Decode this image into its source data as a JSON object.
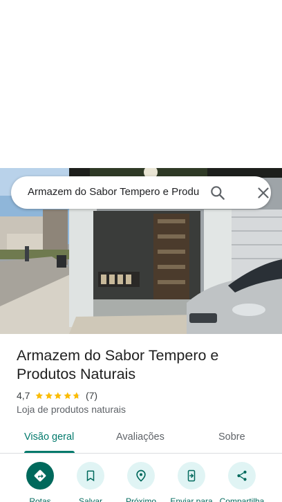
{
  "search": {
    "query": "Armazem do Sabor Tempero e Produtos Naturais"
  },
  "place": {
    "name": "Armazem do Sabor Tempero e Produtos Naturais",
    "rating": "4,7",
    "stars": 4.7,
    "reviews_count": "(7)",
    "category": "Loja de produtos naturais"
  },
  "tabs": [
    {
      "label": "Visão geral",
      "active": true
    },
    {
      "label": "Avaliações",
      "active": false
    },
    {
      "label": "Sobre",
      "active": false
    }
  ],
  "actions": [
    {
      "label": "Rotas",
      "icon": "directions-icon"
    },
    {
      "label": "Salvar",
      "icon": "bookmark-icon"
    },
    {
      "label": "Próximo",
      "icon": "nearby-icon"
    },
    {
      "label": "Enviar para",
      "icon": "send-to-phone-icon"
    },
    {
      "label": "Compartilha",
      "icon": "share-icon"
    }
  ],
  "colors": {
    "accent": "#00796b",
    "star": "#fbbc04",
    "action_bg": "#e0f4f4"
  }
}
